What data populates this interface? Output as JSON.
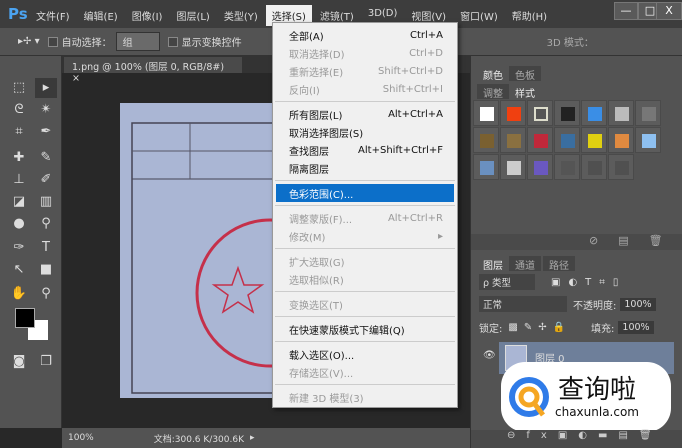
{
  "app": {
    "logo": "Ps",
    "window_controls": [
      "—",
      "□",
      "X"
    ]
  },
  "menubar": [
    "文件(F)",
    "编辑(E)",
    "图像(I)",
    "图层(L)",
    "类型(Y)",
    "选择(S)",
    "滤镜(T)",
    "3D(D)",
    "视图(V)",
    "窗口(W)",
    "帮助(H)"
  ],
  "options": {
    "auto_select_label": "自动选择：",
    "auto_select_value": "组",
    "show_transform": "显示变换控件",
    "mode3d": "3D 模式："
  },
  "document": {
    "tab": "1.png @ 100% (图层 0, RGB/8#)",
    "close": "×"
  },
  "status": {
    "zoom": "100%",
    "doc": "文档:300.6 K/300.6K"
  },
  "menu": [
    {
      "label": "全部(A)",
      "shortcut": "Ctrl+A",
      "enabled": true
    },
    {
      "label": "取消选择(D)",
      "shortcut": "Ctrl+D",
      "enabled": false
    },
    {
      "label": "重新选择(E)",
      "shortcut": "Shift+Ctrl+D",
      "enabled": false
    },
    {
      "label": "反向(I)",
      "shortcut": "Shift+Ctrl+I",
      "enabled": false
    },
    {
      "sep": true
    },
    {
      "label": "所有图层(L)",
      "shortcut": "Alt+Ctrl+A",
      "enabled": true
    },
    {
      "label": "取消选择图层(S)",
      "shortcut": "",
      "enabled": true
    },
    {
      "label": "查找图层",
      "shortcut": "Alt+Shift+Ctrl+F",
      "enabled": true
    },
    {
      "label": "隔离图层",
      "shortcut": "",
      "enabled": true
    },
    {
      "sep": true
    },
    {
      "label": "色彩范围(C)...",
      "shortcut": "",
      "enabled": true,
      "highlighted": true
    },
    {
      "sep": true
    },
    {
      "label": "调整蒙版(F)...",
      "shortcut": "Alt+Ctrl+R",
      "enabled": false
    },
    {
      "label": "修改(M)",
      "shortcut": "▸",
      "enabled": false
    },
    {
      "sep": true
    },
    {
      "label": "扩大选取(G)",
      "shortcut": "",
      "enabled": false
    },
    {
      "label": "选取相似(R)",
      "shortcut": "",
      "enabled": false
    },
    {
      "sep": true
    },
    {
      "label": "变换选区(T)",
      "shortcut": "",
      "enabled": false
    },
    {
      "sep": true
    },
    {
      "label": "在快速蒙版模式下编辑(Q)",
      "shortcut": "",
      "enabled": true
    },
    {
      "sep": true
    },
    {
      "label": "载入选区(O)...",
      "shortcut": "",
      "enabled": true
    },
    {
      "label": "存储选区(V)...",
      "shortcut": "",
      "enabled": false
    },
    {
      "sep": true
    },
    {
      "label": "新建 3D 模型(3)",
      "shortcut": "",
      "enabled": false
    }
  ],
  "panels": {
    "color_tabs": [
      "颜色",
      "色板"
    ],
    "style_tabs": [
      "调整",
      "样式"
    ],
    "layer_tabs": [
      "图层",
      "通道",
      "路径"
    ],
    "filter_kind": "ρ 类型",
    "blend_mode": "正常",
    "opacity_label": "不透明度:",
    "opacity": "100%",
    "lock_label": "锁定:",
    "fill_label": "填充:",
    "fill": "100%",
    "layer_name": "图层 0"
  },
  "watermark": {
    "text": "查询啦",
    "domain": "chaxunla.com"
  },
  "colors": {
    "accent": "#0c6fc9",
    "panel": "#535353"
  }
}
